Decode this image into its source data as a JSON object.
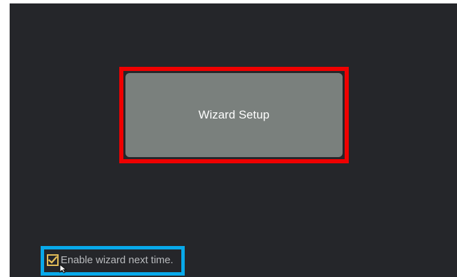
{
  "wizard": {
    "button_label": "Wizard Setup"
  },
  "startup_option": {
    "label": "Enable wizard next time.",
    "checked": true
  },
  "colors": {
    "background": "#25262a",
    "button_fill": "#7a807d",
    "button_highlight": "#f00000",
    "option_highlight": "#08a9ea",
    "checkbox_accent": "#e6bf58"
  },
  "icons": {
    "checkbox": "checkmark-icon",
    "pointer": "mouse-cursor-icon"
  }
}
